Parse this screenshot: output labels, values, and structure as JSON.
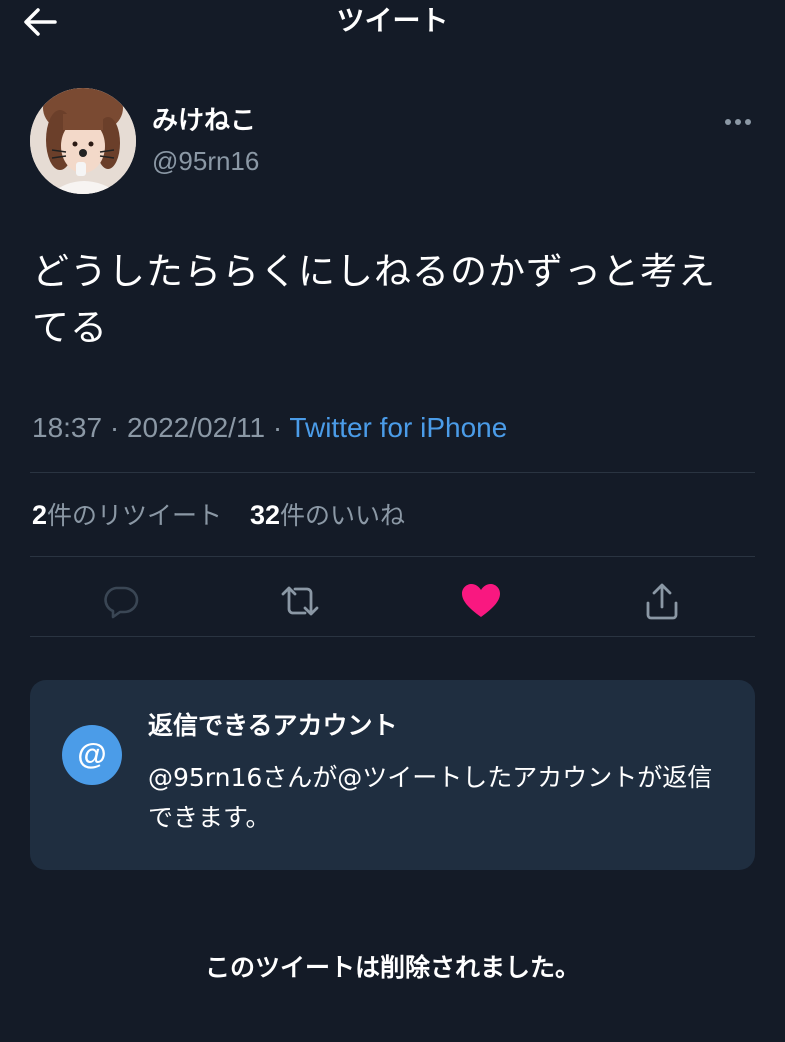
{
  "header": {
    "title": "ツイート",
    "back_icon": "arrow-left-icon"
  },
  "tweet": {
    "author": {
      "display_name": "みけねこ",
      "handle": "@95rn16"
    },
    "text": "どうしたららくにしねるのかずっと考えてる",
    "time": "18:37",
    "date": "2022/02/11",
    "separator": "·",
    "source": "Twitter for iPhone"
  },
  "stats": {
    "retweet_count": "2",
    "retweet_label": "件のリツイート",
    "like_count": "32",
    "like_label": "件のいいね"
  },
  "actions": {
    "icons": [
      "reply-icon",
      "retweet-icon",
      "like-icon",
      "share-icon"
    ],
    "liked": true,
    "like_color": "#f91880"
  },
  "reply_settings": {
    "icon_text": "@",
    "title": "返信できるアカウント",
    "description": "@95rn16さんが@ツイートしたアカウントが返信できます。"
  },
  "footer": {
    "deleted_notice": "このツイートは削除されました。"
  },
  "colors": {
    "background": "#141b27",
    "secondary_text": "#8b98a5",
    "accent": "#4b9ce8",
    "card_background": "#1f2e40"
  }
}
